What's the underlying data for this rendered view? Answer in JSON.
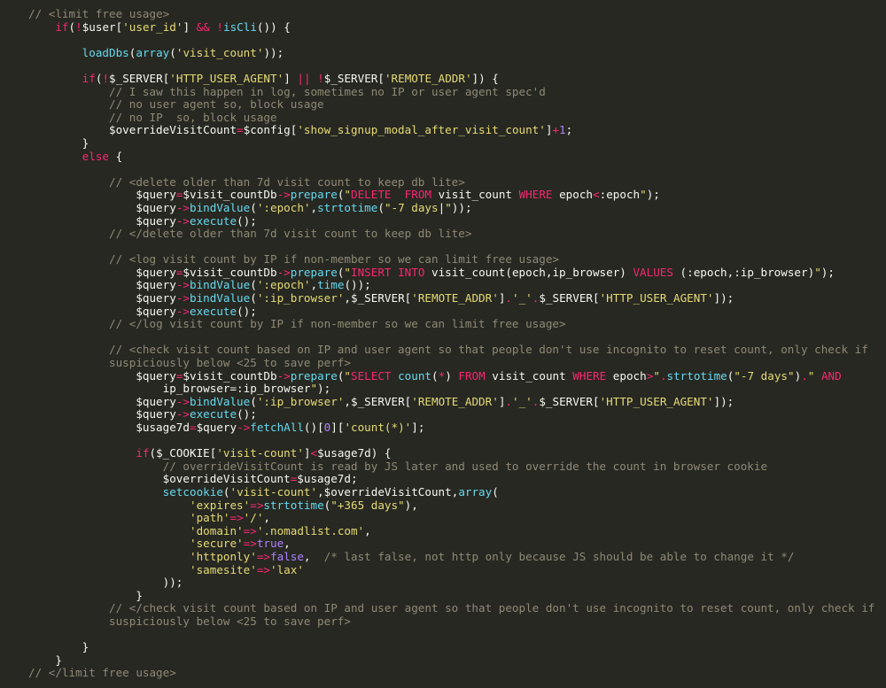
{
  "editor": {
    "lines": [
      [
        [
          "comment",
          "// <limit free usage>"
        ]
      ],
      [
        [
          "plain",
          "    "
        ],
        [
          "keyword",
          "if"
        ],
        [
          "plain",
          "("
        ],
        [
          "op",
          "!"
        ],
        [
          "plain",
          "$user["
        ],
        [
          "string",
          "'user_id'"
        ],
        [
          "plain",
          "] "
        ],
        [
          "op",
          "&&"
        ],
        [
          "plain",
          " "
        ],
        [
          "op",
          "!"
        ],
        [
          "func",
          "isCli"
        ],
        [
          "plain",
          "()) {"
        ]
      ],
      [
        [
          "plain",
          ""
        ]
      ],
      [
        [
          "plain",
          "        "
        ],
        [
          "func",
          "loadDbs"
        ],
        [
          "plain",
          "("
        ],
        [
          "func",
          "array"
        ],
        [
          "plain",
          "("
        ],
        [
          "string",
          "'visit_count'"
        ],
        [
          "plain",
          "));"
        ]
      ],
      [
        [
          "plain",
          ""
        ]
      ],
      [
        [
          "plain",
          "        "
        ],
        [
          "keyword",
          "if"
        ],
        [
          "plain",
          "("
        ],
        [
          "op",
          "!"
        ],
        [
          "plain",
          "$_SERVER["
        ],
        [
          "string",
          "'HTTP_USER_AGENT'"
        ],
        [
          "plain",
          "] "
        ],
        [
          "op",
          "||"
        ],
        [
          "plain",
          " "
        ],
        [
          "op",
          "!"
        ],
        [
          "plain",
          "$_SERVER["
        ],
        [
          "string",
          "'REMOTE_ADDR'"
        ],
        [
          "plain",
          "]) {"
        ]
      ],
      [
        [
          "plain",
          "            "
        ],
        [
          "comment",
          "// I saw this happen in log, sometimes no IP or user agent spec'd"
        ]
      ],
      [
        [
          "plain",
          "            "
        ],
        [
          "comment",
          "// no user agent so, block usage"
        ]
      ],
      [
        [
          "plain",
          "            "
        ],
        [
          "comment",
          "// no IP  so, block usage"
        ]
      ],
      [
        [
          "plain",
          "            $overrideVisitCount"
        ],
        [
          "op",
          "="
        ],
        [
          "plain",
          "$config["
        ],
        [
          "string",
          "'show_signup_modal_after_visit_count'"
        ],
        [
          "plain",
          "]"
        ],
        [
          "op",
          "+"
        ],
        [
          "number",
          "1"
        ],
        [
          "plain",
          ";"
        ]
      ],
      [
        [
          "plain",
          "        }"
        ]
      ],
      [
        [
          "plain",
          "        "
        ],
        [
          "keyword",
          "else"
        ],
        [
          "plain",
          " {"
        ]
      ],
      [
        [
          "plain",
          ""
        ]
      ],
      [
        [
          "plain",
          "            "
        ],
        [
          "comment",
          "// <delete older than 7d visit count to keep db lite>"
        ]
      ],
      [
        [
          "plain",
          "                $query"
        ],
        [
          "op",
          "="
        ],
        [
          "plain",
          "$visit_countDb"
        ],
        [
          "op",
          "->"
        ],
        [
          "func",
          "prepare"
        ],
        [
          "plain",
          "("
        ],
        [
          "string",
          "\""
        ],
        [
          "keyword",
          "DELETE"
        ],
        [
          "plain",
          "  "
        ],
        [
          "keyword",
          "FROM"
        ],
        [
          "plain",
          " visit_count "
        ],
        [
          "keyword",
          "WHERE"
        ],
        [
          "plain",
          " epoch"
        ],
        [
          "op",
          "<"
        ],
        [
          "plain",
          ":epoch"
        ],
        [
          "string",
          "\""
        ],
        [
          "plain",
          ");"
        ]
      ],
      [
        [
          "plain",
          "                $query"
        ],
        [
          "op",
          "->"
        ],
        [
          "func",
          "bindValue"
        ],
        [
          "plain",
          "("
        ],
        [
          "string",
          "':epoch'"
        ],
        [
          "plain",
          ","
        ],
        [
          "func",
          "strtotime"
        ],
        [
          "plain",
          "("
        ],
        [
          "string",
          "\"-7 days"
        ],
        [
          "cursor",
          "|"
        ],
        [
          "string",
          "\""
        ],
        [
          "plain",
          "));"
        ]
      ],
      [
        [
          "plain",
          "                $query"
        ],
        [
          "op",
          "->"
        ],
        [
          "func",
          "execute"
        ],
        [
          "plain",
          "();"
        ]
      ],
      [
        [
          "plain",
          "            "
        ],
        [
          "comment",
          "// </delete older than 7d visit count to keep db lite>"
        ]
      ],
      [
        [
          "plain",
          ""
        ]
      ],
      [
        [
          "plain",
          "            "
        ],
        [
          "comment",
          "// <log visit count by IP if non-member so we can limit free usage>"
        ]
      ],
      [
        [
          "plain",
          "                $query"
        ],
        [
          "op",
          "="
        ],
        [
          "plain",
          "$visit_countDb"
        ],
        [
          "op",
          "->"
        ],
        [
          "func",
          "prepare"
        ],
        [
          "plain",
          "("
        ],
        [
          "string",
          "\""
        ],
        [
          "keyword",
          "INSERT INTO"
        ],
        [
          "plain",
          " visit_count(epoch,ip_browser) "
        ],
        [
          "keyword",
          "VALUES"
        ],
        [
          "plain",
          " (:epoch,:ip_browser)"
        ],
        [
          "string",
          "\""
        ],
        [
          "plain",
          ");"
        ]
      ],
      [
        [
          "plain",
          "                $query"
        ],
        [
          "op",
          "->"
        ],
        [
          "func",
          "bindValue"
        ],
        [
          "plain",
          "("
        ],
        [
          "string",
          "':epoch'"
        ],
        [
          "plain",
          ","
        ],
        [
          "func",
          "time"
        ],
        [
          "plain",
          "());"
        ]
      ],
      [
        [
          "plain",
          "                $query"
        ],
        [
          "op",
          "->"
        ],
        [
          "func",
          "bindValue"
        ],
        [
          "plain",
          "("
        ],
        [
          "string",
          "':ip_browser'"
        ],
        [
          "plain",
          ",$_SERVER["
        ],
        [
          "string",
          "'REMOTE_ADDR'"
        ],
        [
          "plain",
          "]"
        ],
        [
          "op",
          "."
        ],
        [
          "string",
          "'_'"
        ],
        [
          "op",
          "."
        ],
        [
          "plain",
          "$_SERVER["
        ],
        [
          "string",
          "'HTTP_USER_AGENT'"
        ],
        [
          "plain",
          "]);"
        ]
      ],
      [
        [
          "plain",
          "                $query"
        ],
        [
          "op",
          "->"
        ],
        [
          "func",
          "execute"
        ],
        [
          "plain",
          "();"
        ]
      ],
      [
        [
          "plain",
          "            "
        ],
        [
          "comment",
          "// </log visit count by IP if non-member so we can limit free usage>"
        ]
      ],
      [
        [
          "plain",
          ""
        ]
      ],
      [
        [
          "plain",
          "            "
        ],
        [
          "comment",
          "// <check visit count based on IP and user agent so that people don't use incognito to reset count, only check if"
        ]
      ],
      [
        [
          "plain",
          "            "
        ],
        [
          "comment",
          "suspiciously below <25 to save perf>"
        ]
      ],
      [
        [
          "plain",
          "                $query"
        ],
        [
          "op",
          "="
        ],
        [
          "plain",
          "$visit_countDb"
        ],
        [
          "op",
          "->"
        ],
        [
          "func",
          "prepare"
        ],
        [
          "plain",
          "("
        ],
        [
          "string",
          "\""
        ],
        [
          "keyword",
          "SELECT"
        ],
        [
          "plain",
          " "
        ],
        [
          "func",
          "count"
        ],
        [
          "plain",
          "("
        ],
        [
          "op",
          "*"
        ],
        [
          "plain",
          ") "
        ],
        [
          "keyword",
          "FROM"
        ],
        [
          "plain",
          " visit_count "
        ],
        [
          "keyword",
          "WHERE"
        ],
        [
          "plain",
          " epoch"
        ],
        [
          "op",
          ">"
        ],
        [
          "string",
          "\""
        ],
        [
          "op",
          "."
        ],
        [
          "func",
          "strtotime"
        ],
        [
          "plain",
          "("
        ],
        [
          "string",
          "\"-7 days\""
        ],
        [
          "plain",
          ")"
        ],
        [
          "op",
          "."
        ],
        [
          "string",
          "\" "
        ],
        [
          "keyword",
          "AND"
        ]
      ],
      [
        [
          "plain",
          "                    ip_browser=:ip_browser"
        ],
        [
          "string",
          "\""
        ],
        [
          "plain",
          ");"
        ]
      ],
      [
        [
          "plain",
          "                $query"
        ],
        [
          "op",
          "->"
        ],
        [
          "func",
          "bindValue"
        ],
        [
          "plain",
          "("
        ],
        [
          "string",
          "':ip_browser'"
        ],
        [
          "plain",
          ",$_SERVER["
        ],
        [
          "string",
          "'REMOTE_ADDR'"
        ],
        [
          "plain",
          "]"
        ],
        [
          "op",
          "."
        ],
        [
          "string",
          "'_'"
        ],
        [
          "op",
          "."
        ],
        [
          "plain",
          "$_SERVER["
        ],
        [
          "string",
          "'HTTP_USER_AGENT'"
        ],
        [
          "plain",
          "]);"
        ]
      ],
      [
        [
          "plain",
          "                $query"
        ],
        [
          "op",
          "->"
        ],
        [
          "func",
          "execute"
        ],
        [
          "plain",
          "();"
        ]
      ],
      [
        [
          "plain",
          "                $usage7d"
        ],
        [
          "op",
          "="
        ],
        [
          "plain",
          "$query"
        ],
        [
          "op",
          "->"
        ],
        [
          "func",
          "fetchAll"
        ],
        [
          "plain",
          "()["
        ],
        [
          "number",
          "0"
        ],
        [
          "plain",
          "]["
        ],
        [
          "string",
          "'count(*)'"
        ],
        [
          "plain",
          "];"
        ]
      ],
      [
        [
          "plain",
          ""
        ]
      ],
      [
        [
          "plain",
          "                "
        ],
        [
          "keyword",
          "if"
        ],
        [
          "plain",
          "($_COOKIE["
        ],
        [
          "string",
          "'visit-count'"
        ],
        [
          "plain",
          "]"
        ],
        [
          "op",
          "<"
        ],
        [
          "plain",
          "$usage7d) {"
        ]
      ],
      [
        [
          "plain",
          "                    "
        ],
        [
          "comment",
          "// overrideVisitCount is read by JS later and used to override the count in browser cookie"
        ]
      ],
      [
        [
          "plain",
          "                    $overrideVisitCount"
        ],
        [
          "op",
          "="
        ],
        [
          "plain",
          "$usage7d;"
        ]
      ],
      [
        [
          "plain",
          "                    "
        ],
        [
          "func",
          "setcookie"
        ],
        [
          "plain",
          "("
        ],
        [
          "string",
          "'visit-count'"
        ],
        [
          "plain",
          ",$overrideVisitCount,"
        ],
        [
          "func",
          "array"
        ],
        [
          "plain",
          "("
        ]
      ],
      [
        [
          "plain",
          "                        "
        ],
        [
          "string",
          "'expires'"
        ],
        [
          "op",
          "=>"
        ],
        [
          "func",
          "strtotime"
        ],
        [
          "plain",
          "("
        ],
        [
          "string",
          "\"+365 days\""
        ],
        [
          "plain",
          "),"
        ]
      ],
      [
        [
          "plain",
          "                        "
        ],
        [
          "string",
          "'path'"
        ],
        [
          "op",
          "=>"
        ],
        [
          "string",
          "'/'"
        ],
        [
          "plain",
          ","
        ]
      ],
      [
        [
          "plain",
          "                        "
        ],
        [
          "string",
          "'domain'"
        ],
        [
          "op",
          "=>"
        ],
        [
          "string",
          "'.nomadlist.com'"
        ],
        [
          "plain",
          ","
        ]
      ],
      [
        [
          "plain",
          "                        "
        ],
        [
          "string",
          "'secure'"
        ],
        [
          "op",
          "=>"
        ],
        [
          "const",
          "true"
        ],
        [
          "plain",
          ","
        ]
      ],
      [
        [
          "plain",
          "                        "
        ],
        [
          "string",
          "'httponly'"
        ],
        [
          "op",
          "=>"
        ],
        [
          "const",
          "false"
        ],
        [
          "plain",
          ",  "
        ],
        [
          "comment",
          "/* last false, not http only because JS should be able to change it */"
        ]
      ],
      [
        [
          "plain",
          "                        "
        ],
        [
          "string",
          "'samesite'"
        ],
        [
          "op",
          "=>"
        ],
        [
          "string",
          "'lax'"
        ]
      ],
      [
        [
          "plain",
          "                    ));"
        ]
      ],
      [
        [
          "plain",
          "                }"
        ]
      ],
      [
        [
          "plain",
          "            "
        ],
        [
          "comment",
          "// </check visit count based on IP and user agent so that people don't use incognito to reset count, only check if"
        ]
      ],
      [
        [
          "plain",
          "            "
        ],
        [
          "comment",
          "suspiciously below <25 to save perf>"
        ]
      ],
      [
        [
          "plain",
          ""
        ]
      ],
      [
        [
          "plain",
          "        }"
        ]
      ],
      [
        [
          "plain",
          "    }"
        ]
      ],
      [
        [
          "comment",
          "// </limit free usage>"
        ]
      ]
    ]
  }
}
